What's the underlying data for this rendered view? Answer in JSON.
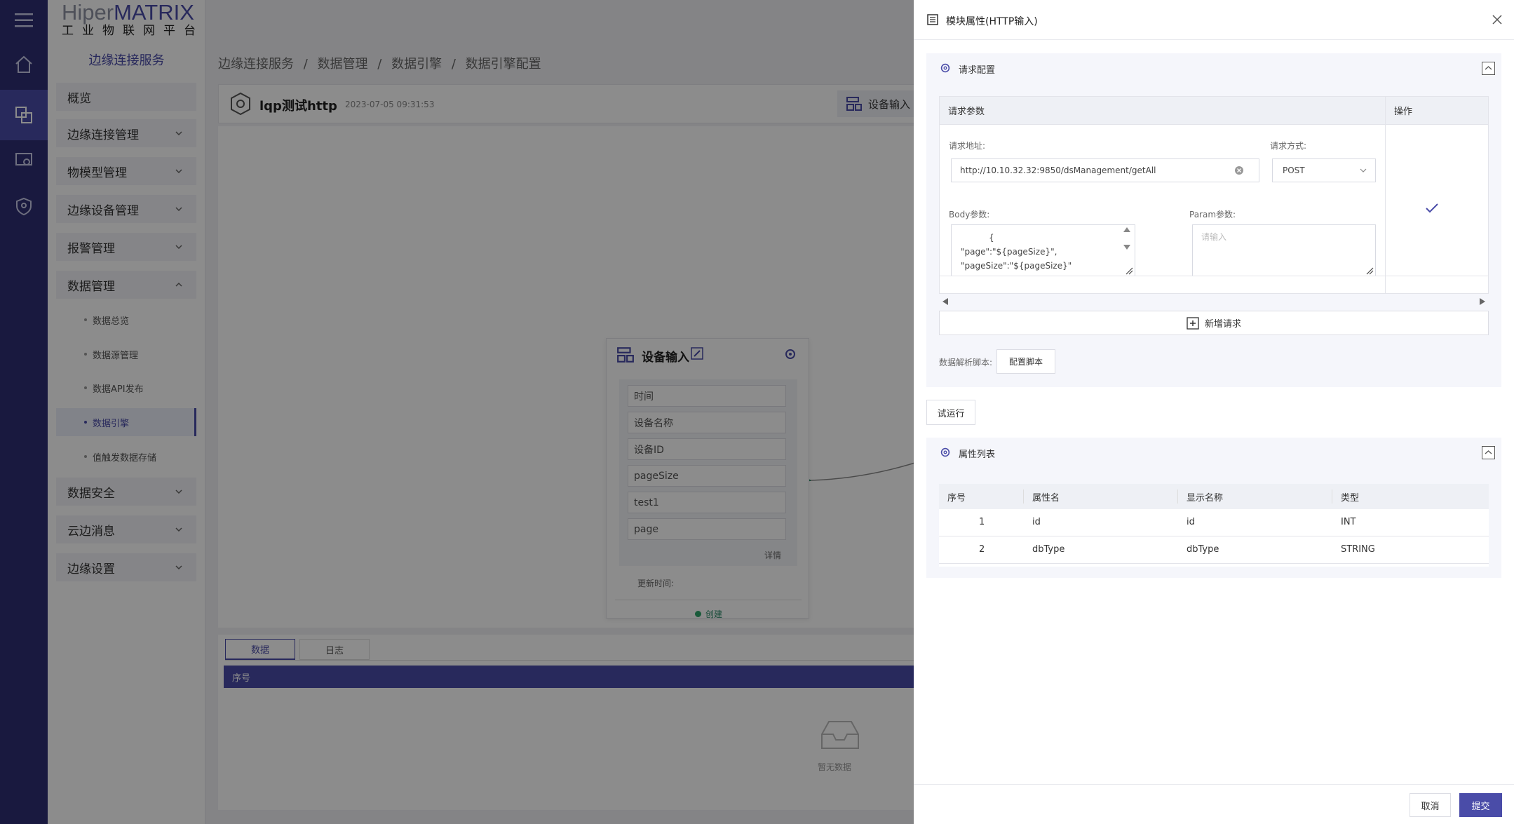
{
  "logo": {
    "brand_a": "Hiper",
    "brand_b": "MATRIX",
    "subtitle": "工业物联网平台"
  },
  "side_nav": {
    "service": "边缘连接服务",
    "items": [
      {
        "label": "概览",
        "has_chevron": false
      },
      {
        "label": "边缘连接管理",
        "has_chevron": true
      },
      {
        "label": "物模型管理",
        "has_chevron": true
      },
      {
        "label": "边缘设备管理",
        "has_chevron": true
      },
      {
        "label": "报警管理",
        "has_chevron": true
      },
      {
        "label": "数据管理",
        "expanded": true
      }
    ],
    "sub_items": [
      "数据总览",
      "数据源管理",
      "数据API发布",
      "数据引擎",
      "值触发数据存储"
    ],
    "active_sub": "数据引擎",
    "items_after": [
      "数据安全",
      "云边消息",
      "边缘设置"
    ]
  },
  "breadcrumb": [
    "边缘连接服务",
    "数据管理",
    "数据引擎",
    "数据引擎配置"
  ],
  "engine": {
    "name": "lqp测试http",
    "timestamp": "2023-07-05 09:31:53",
    "toolbar_button": "设备输入"
  },
  "node": {
    "title": "设备输入",
    "fields": [
      "时间",
      "设备名称",
      "设备ID",
      "pageSize",
      "test1",
      "page"
    ],
    "detail_link": "详情",
    "update_label": "更新时间:",
    "status": "创建"
  },
  "bottom_panel": {
    "tabs": [
      "数据",
      "日志"
    ],
    "active_tab": "数据",
    "column": "序号",
    "empty_text": "暂无数据"
  },
  "drawer": {
    "title": "模块属性(HTTP输入)",
    "request_config": {
      "title": "请求配置",
      "table_header": "请求参数",
      "action_header": "操作",
      "url_label": "请求地址:",
      "url_value": "http://10.10.32.32:9850/dsManagement/getAll",
      "method_label": "请求方式:",
      "method_value": "POST",
      "body_label": "Body参数:",
      "body_lines": [
        "{",
        "\"page\":\"${pageSize}\",",
        "\"pageSize\":\"${pageSize}\""
      ],
      "param_label": "Param参数:",
      "param_placeholder": "请输入",
      "add_request": "新增请求",
      "script_label": "数据解析脚本:",
      "script_button": "配置脚本"
    },
    "trial_button": "试运行",
    "attributes": {
      "title": "属性列表",
      "columns": [
        "序号",
        "属性名",
        "显示名称",
        "类型"
      ],
      "rows": [
        {
          "index": "1",
          "name": "id",
          "display": "id",
          "type": "INT"
        },
        {
          "index": "2",
          "name": "dbType",
          "display": "dbType",
          "type": "STRING"
        }
      ]
    },
    "cancel": "取消",
    "submit": "提交"
  },
  "colors": {
    "accent": "#4a4ca8",
    "rail": "#2f2f73",
    "link_line": "#2e8b6a"
  }
}
